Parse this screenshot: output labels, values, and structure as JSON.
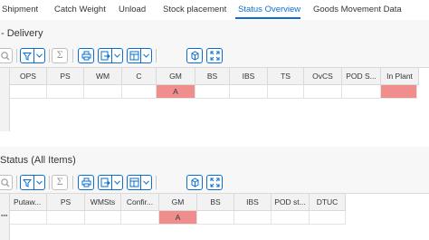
{
  "tabs": [
    {
      "label": "Shipment"
    },
    {
      "label": "Catch Weight"
    },
    {
      "label": "Unload"
    },
    {
      "label": "Stock placement"
    },
    {
      "label": "Status Overview",
      "active": true
    },
    {
      "label": "Goods Movement Data"
    }
  ],
  "delivery_section": {
    "title": "- Delivery",
    "columns": [
      "OPS",
      "PS",
      "WM",
      "C",
      "GM",
      "BS",
      "IBS",
      "TS",
      "OvCS",
      "POD S...",
      "In Plant"
    ],
    "row": {
      "GM": "A"
    }
  },
  "items_section": {
    "title": "Status (All Items)",
    "columns": [
      "Putaw...",
      "PS",
      "WMSts",
      "Confir...",
      "GM",
      "BS",
      "IBS",
      "POD st...",
      "DTUC"
    ],
    "row": {
      "GM": "A"
    }
  },
  "toolbar": {
    "icons": [
      "magnifier-icon",
      "filter-icon",
      "sum-icon",
      "print-icon",
      "export-icon",
      "layout-icon",
      "details-icon",
      "fullscreen-icon"
    ]
  },
  "colors": {
    "accent": "#0a6ed1",
    "status_highlight": "#f08e8e"
  }
}
